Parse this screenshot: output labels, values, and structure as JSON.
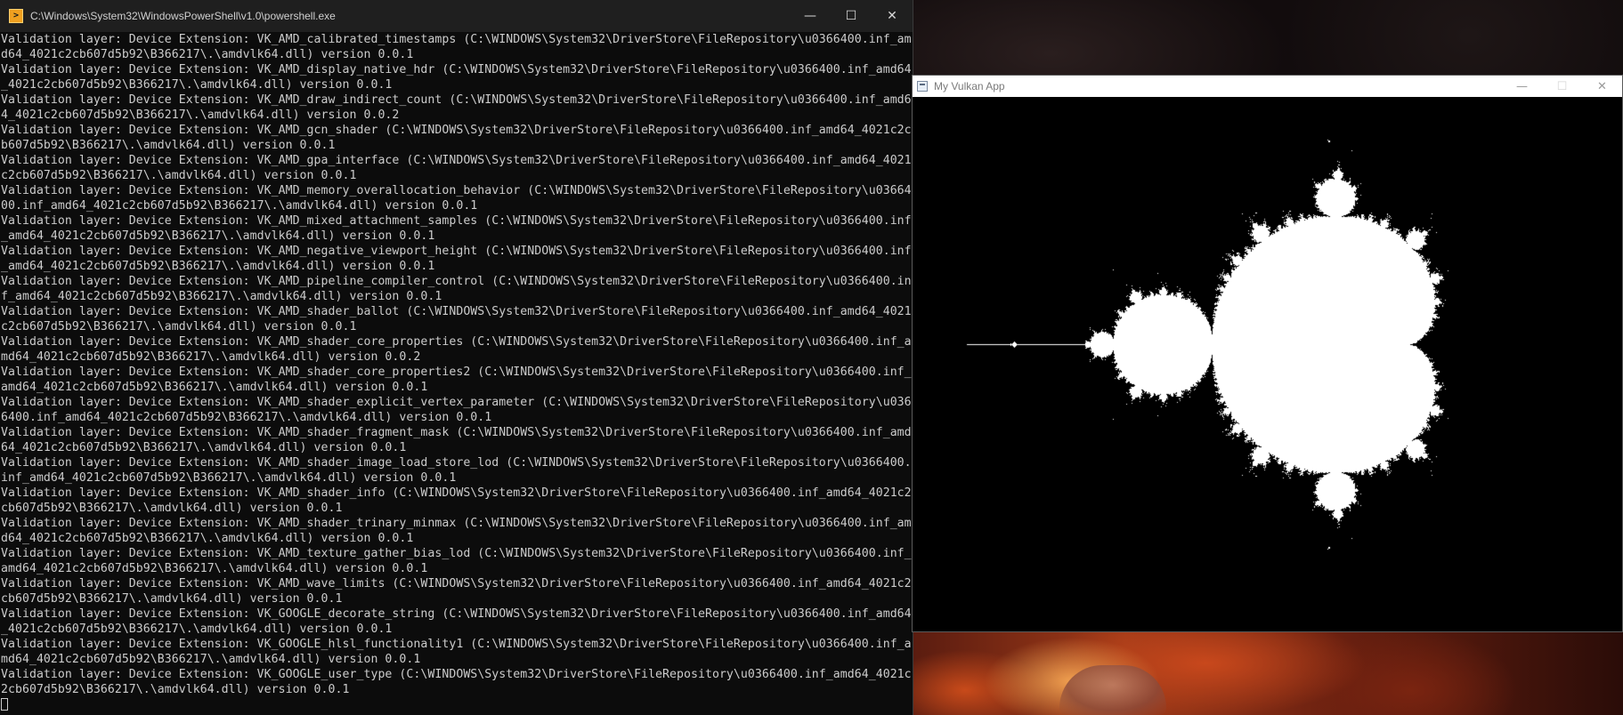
{
  "powershell": {
    "title": "C:\\Windows\\System32\\WindowsPowerShell\\v1.0\\powershell.exe",
    "icon": "powershell-icon",
    "lines": [
      "Validation layer: Device Extension: VK_AMD_calibrated_timestamps (C:\\WINDOWS\\System32\\DriverStore\\FileRepository\\u0366400.inf_am",
      "d64_4021c2cb607d5b92\\B366217\\.\\amdvlk64.dll) version 0.0.1",
      "Validation layer: Device Extension: VK_AMD_display_native_hdr (C:\\WINDOWS\\System32\\DriverStore\\FileRepository\\u0366400.inf_amd64",
      "_4021c2cb607d5b92\\B366217\\.\\amdvlk64.dll) version 0.0.1",
      "Validation layer: Device Extension: VK_AMD_draw_indirect_count (C:\\WINDOWS\\System32\\DriverStore\\FileRepository\\u0366400.inf_amd6",
      "4_4021c2cb607d5b92\\B366217\\.\\amdvlk64.dll) version 0.0.2",
      "Validation layer: Device Extension: VK_AMD_gcn_shader (C:\\WINDOWS\\System32\\DriverStore\\FileRepository\\u0366400.inf_amd64_4021c2c",
      "b607d5b92\\B366217\\.\\amdvlk64.dll) version 0.0.1",
      "Validation layer: Device Extension: VK_AMD_gpa_interface (C:\\WINDOWS\\System32\\DriverStore\\FileRepository\\u0366400.inf_amd64_4021",
      "c2cb607d5b92\\B366217\\.\\amdvlk64.dll) version 0.0.1",
      "Validation layer: Device Extension: VK_AMD_memory_overallocation_behavior (C:\\WINDOWS\\System32\\DriverStore\\FileRepository\\u03664",
      "00.inf_amd64_4021c2cb607d5b92\\B366217\\.\\amdvlk64.dll) version 0.0.1",
      "Validation layer: Device Extension: VK_AMD_mixed_attachment_samples (C:\\WINDOWS\\System32\\DriverStore\\FileRepository\\u0366400.inf",
      "_amd64_4021c2cb607d5b92\\B366217\\.\\amdvlk64.dll) version 0.0.1",
      "Validation layer: Device Extension: VK_AMD_negative_viewport_height (C:\\WINDOWS\\System32\\DriverStore\\FileRepository\\u0366400.inf",
      "_amd64_4021c2cb607d5b92\\B366217\\.\\amdvlk64.dll) version 0.0.1",
      "Validation layer: Device Extension: VK_AMD_pipeline_compiler_control (C:\\WINDOWS\\System32\\DriverStore\\FileRepository\\u0366400.in",
      "f_amd64_4021c2cb607d5b92\\B366217\\.\\amdvlk64.dll) version 0.0.1",
      "Validation layer: Device Extension: VK_AMD_shader_ballot (C:\\WINDOWS\\System32\\DriverStore\\FileRepository\\u0366400.inf_amd64_4021",
      "c2cb607d5b92\\B366217\\.\\amdvlk64.dll) version 0.0.1",
      "Validation layer: Device Extension: VK_AMD_shader_core_properties (C:\\WINDOWS\\System32\\DriverStore\\FileRepository\\u0366400.inf_a",
      "md64_4021c2cb607d5b92\\B366217\\.\\amdvlk64.dll) version 0.0.2",
      "Validation layer: Device Extension: VK_AMD_shader_core_properties2 (C:\\WINDOWS\\System32\\DriverStore\\FileRepository\\u0366400.inf_",
      "amd64_4021c2cb607d5b92\\B366217\\.\\amdvlk64.dll) version 0.0.1",
      "Validation layer: Device Extension: VK_AMD_shader_explicit_vertex_parameter (C:\\WINDOWS\\System32\\DriverStore\\FileRepository\\u036",
      "6400.inf_amd64_4021c2cb607d5b92\\B366217\\.\\amdvlk64.dll) version 0.0.1",
      "Validation layer: Device Extension: VK_AMD_shader_fragment_mask (C:\\WINDOWS\\System32\\DriverStore\\FileRepository\\u0366400.inf_amd",
      "64_4021c2cb607d5b92\\B366217\\.\\amdvlk64.dll) version 0.0.1",
      "Validation layer: Device Extension: VK_AMD_shader_image_load_store_lod (C:\\WINDOWS\\System32\\DriverStore\\FileRepository\\u0366400.",
      "inf_amd64_4021c2cb607d5b92\\B366217\\.\\amdvlk64.dll) version 0.0.1",
      "Validation layer: Device Extension: VK_AMD_shader_info (C:\\WINDOWS\\System32\\DriverStore\\FileRepository\\u0366400.inf_amd64_4021c2",
      "cb607d5b92\\B366217\\.\\amdvlk64.dll) version 0.0.1",
      "Validation layer: Device Extension: VK_AMD_shader_trinary_minmax (C:\\WINDOWS\\System32\\DriverStore\\FileRepository\\u0366400.inf_am",
      "d64_4021c2cb607d5b92\\B366217\\.\\amdvlk64.dll) version 0.0.1",
      "Validation layer: Device Extension: VK_AMD_texture_gather_bias_lod (C:\\WINDOWS\\System32\\DriverStore\\FileRepository\\u0366400.inf_",
      "amd64_4021c2cb607d5b92\\B366217\\.\\amdvlk64.dll) version 0.0.1",
      "Validation layer: Device Extension: VK_AMD_wave_limits (C:\\WINDOWS\\System32\\DriverStore\\FileRepository\\u0366400.inf_amd64_4021c2",
      "cb607d5b92\\B366217\\.\\amdvlk64.dll) version 0.0.1",
      "Validation layer: Device Extension: VK_GOOGLE_decorate_string (C:\\WINDOWS\\System32\\DriverStore\\FileRepository\\u0366400.inf_amd64",
      "_4021c2cb607d5b92\\B366217\\.\\amdvlk64.dll) version 0.0.1",
      "Validation layer: Device Extension: VK_GOOGLE_hlsl_functionality1 (C:\\WINDOWS\\System32\\DriverStore\\FileRepository\\u0366400.inf_a",
      "md64_4021c2cb607d5b92\\B366217\\.\\amdvlk64.dll) version 0.0.1",
      "Validation layer: Device Extension: VK_GOOGLE_user_type (C:\\WINDOWS\\System32\\DriverStore\\FileRepository\\u0366400.inf_amd64_4021c",
      "2cb607d5b92\\B366217\\.\\amdvlk64.dll) version 0.0.1"
    ]
  },
  "vulkan": {
    "title": "My Vulkan App",
    "icon": "window-app-icon",
    "render": "mandelbrot-set",
    "colors": {
      "inside": "#ffffff",
      "outside": "#000000"
    }
  },
  "caption_buttons": {
    "minimize": "—",
    "maximize": "☐",
    "close": "✕"
  }
}
